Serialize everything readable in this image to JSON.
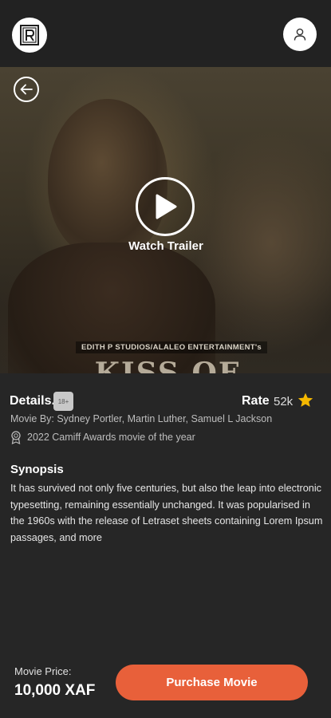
{
  "header": {
    "logo_icon": "film-logo-icon",
    "profile_icon": "user-icon"
  },
  "hero": {
    "watch_trailer_label": "Watch Trailer",
    "studio_text": "EDITH P STUDIOS/ALALEO ENTERTAINMENT's",
    "title_text": "KISS OF DEATH"
  },
  "details": {
    "label": "Details.",
    "age_rating": "18+",
    "rate_label": "Rate",
    "rate_value": "52k",
    "cast": "Movie By: Sydney Portler, Martin Luther, Samuel L Jackson",
    "award": "2022 Camiff Awards movie of the year"
  },
  "synopsis": {
    "title": "Synopsis",
    "text": "It has survived not only five centuries, but also the leap into electronic typesetting, remaining essentially unchanged. It was popularised in the 1960s with the release of Letraset sheets containing Lorem Ipsum passages, and more"
  },
  "purchase": {
    "price_label": "Movie Price:",
    "price": "10,000 XAF",
    "button_label": "Purchase Movie"
  },
  "colors": {
    "accent": "#e8603a",
    "star": "#f5b800",
    "background": "#262626"
  }
}
